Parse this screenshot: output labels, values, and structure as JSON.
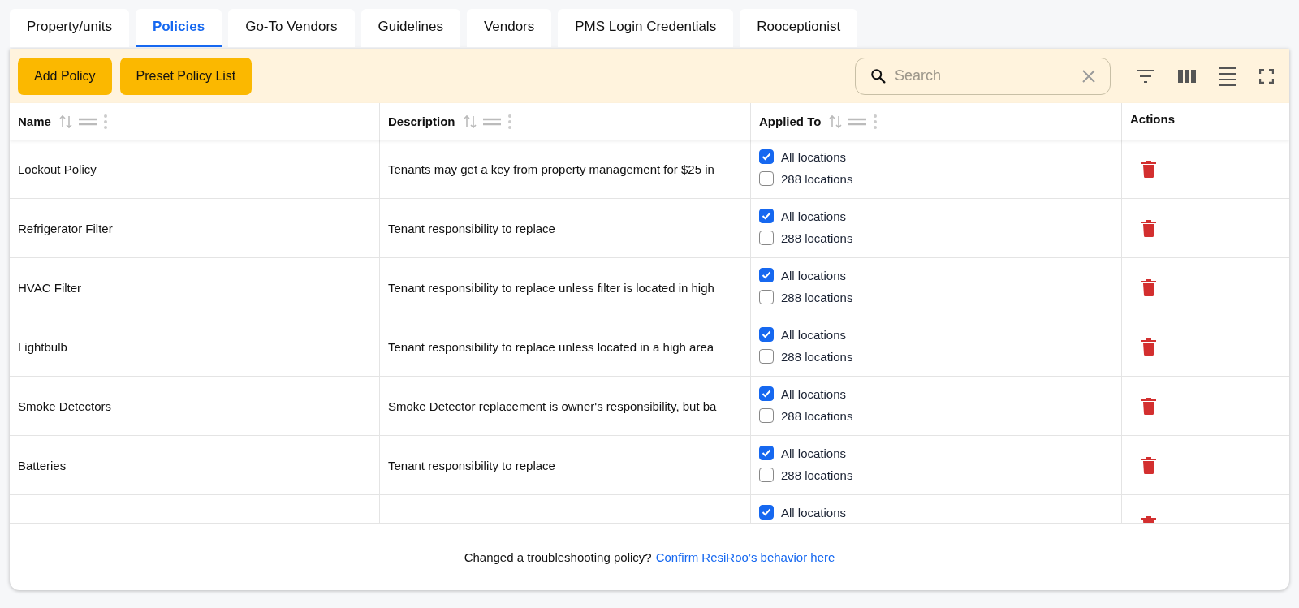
{
  "tabs": [
    {
      "label": "Property/units",
      "selected": false
    },
    {
      "label": "Policies",
      "selected": true
    },
    {
      "label": "Go-To Vendors",
      "selected": false
    },
    {
      "label": "Guidelines",
      "selected": false
    },
    {
      "label": "Vendors",
      "selected": false
    },
    {
      "label": "PMS Login Credentials",
      "selected": false
    },
    {
      "label": "Rooceptionist",
      "selected": false
    }
  ],
  "toolbar": {
    "buttons": [
      "Add Policy",
      "Preset Policy List"
    ],
    "search": {
      "placeholder": "Search"
    }
  },
  "table": {
    "columns": [
      {
        "label": "Name",
        "controls": true
      },
      {
        "label": "Description",
        "controls": true
      },
      {
        "label": "Applied To",
        "controls": true
      },
      {
        "label": "Actions",
        "controls": false
      }
    ],
    "rows": [
      {
        "name": "Lockout Policy",
        "description": "Tenants may get a key from property management for $25 in",
        "applied": [
          {
            "label": "All locations",
            "checked": true
          },
          {
            "label": "288 locations",
            "checked": false
          }
        ]
      },
      {
        "name": "Refrigerator Filter",
        "description": "Tenant responsibility to replace",
        "applied": [
          {
            "label": "All locations",
            "checked": true
          },
          {
            "label": "288 locations",
            "checked": false
          }
        ]
      },
      {
        "name": "HVAC Filter",
        "description": "Tenant responsibility to replace unless filter is located in high",
        "applied": [
          {
            "label": "All locations",
            "checked": true
          },
          {
            "label": "288 locations",
            "checked": false
          }
        ]
      },
      {
        "name": "Lightbulb",
        "description": "Tenant responsibility to replace unless located in a high area",
        "applied": [
          {
            "label": "All locations",
            "checked": true
          },
          {
            "label": "288 locations",
            "checked": false
          }
        ]
      },
      {
        "name": "Smoke Detectors",
        "description": "Smoke Detector replacement is owner's responsibility, but ba",
        "applied": [
          {
            "label": "All locations",
            "checked": true
          },
          {
            "label": "288 locations",
            "checked": false
          }
        ]
      },
      {
        "name": "Batteries",
        "description": "Tenant responsibility to replace",
        "applied": [
          {
            "label": "All locations",
            "checked": true
          },
          {
            "label": "288 locations",
            "checked": false
          }
        ]
      },
      {
        "applied": [
          {
            "label": "All locations",
            "checked": true
          }
        ]
      }
    ]
  },
  "footer": {
    "text": "Changed a troubleshooting policy?",
    "link": "Confirm ResiRoo’s behavior here"
  }
}
